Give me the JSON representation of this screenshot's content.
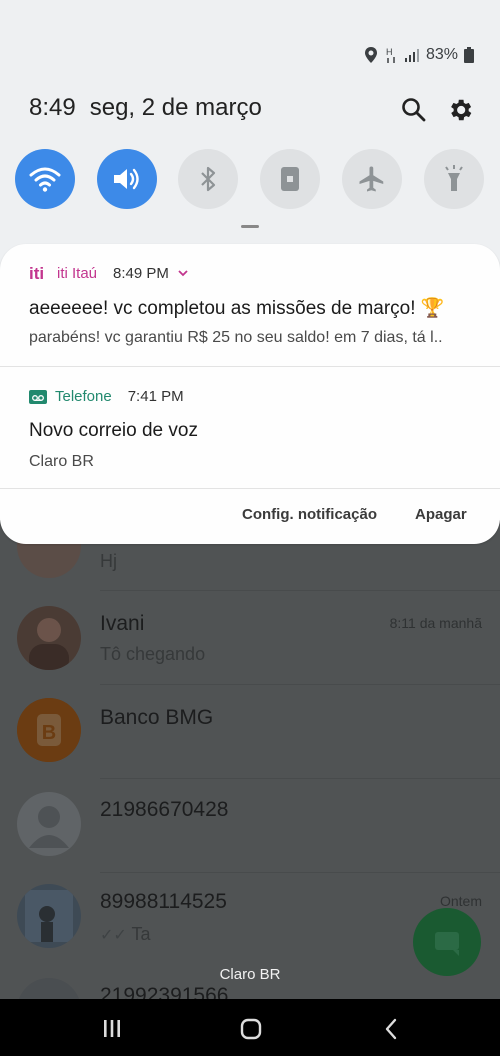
{
  "status_bar": {
    "battery": "83%"
  },
  "quick_panel": {
    "time": "8:49",
    "date": "seg, 2 de março"
  },
  "notifications": [
    {
      "app": "iti Itaú",
      "app_color": "#c2358e",
      "time": "8:49 PM",
      "title": "aeeeeee! vc completou as missões de março! 🏆",
      "body": "parabéns! vc garantiu R$ 25 no seu saldo! em 7 dias, tá l.."
    },
    {
      "app": "Telefone",
      "app_color": "#22896e",
      "time": "7:41 PM",
      "title": "Novo correio de voz",
      "body": "Claro BR"
    }
  ],
  "actions": {
    "settings": "Config. notificação",
    "clear": "Apagar"
  },
  "background_chats": [
    {
      "name": "",
      "preview": "Hj",
      "time": ""
    },
    {
      "name": "Ivani",
      "preview": "Tô chegando",
      "time": "8:11 da manhã"
    },
    {
      "name": "Banco BMG",
      "preview": "",
      "time": ""
    },
    {
      "name": "21986670428",
      "preview": "",
      "time": ""
    },
    {
      "name": "89988114525",
      "preview": "Ta",
      "time": "Ontem"
    },
    {
      "name": "21992391566",
      "preview": "",
      "time": ""
    }
  ],
  "carrier": "Claro BR",
  "colors": {
    "accent": "#3d8ae8",
    "fab": "#1a5a31"
  }
}
